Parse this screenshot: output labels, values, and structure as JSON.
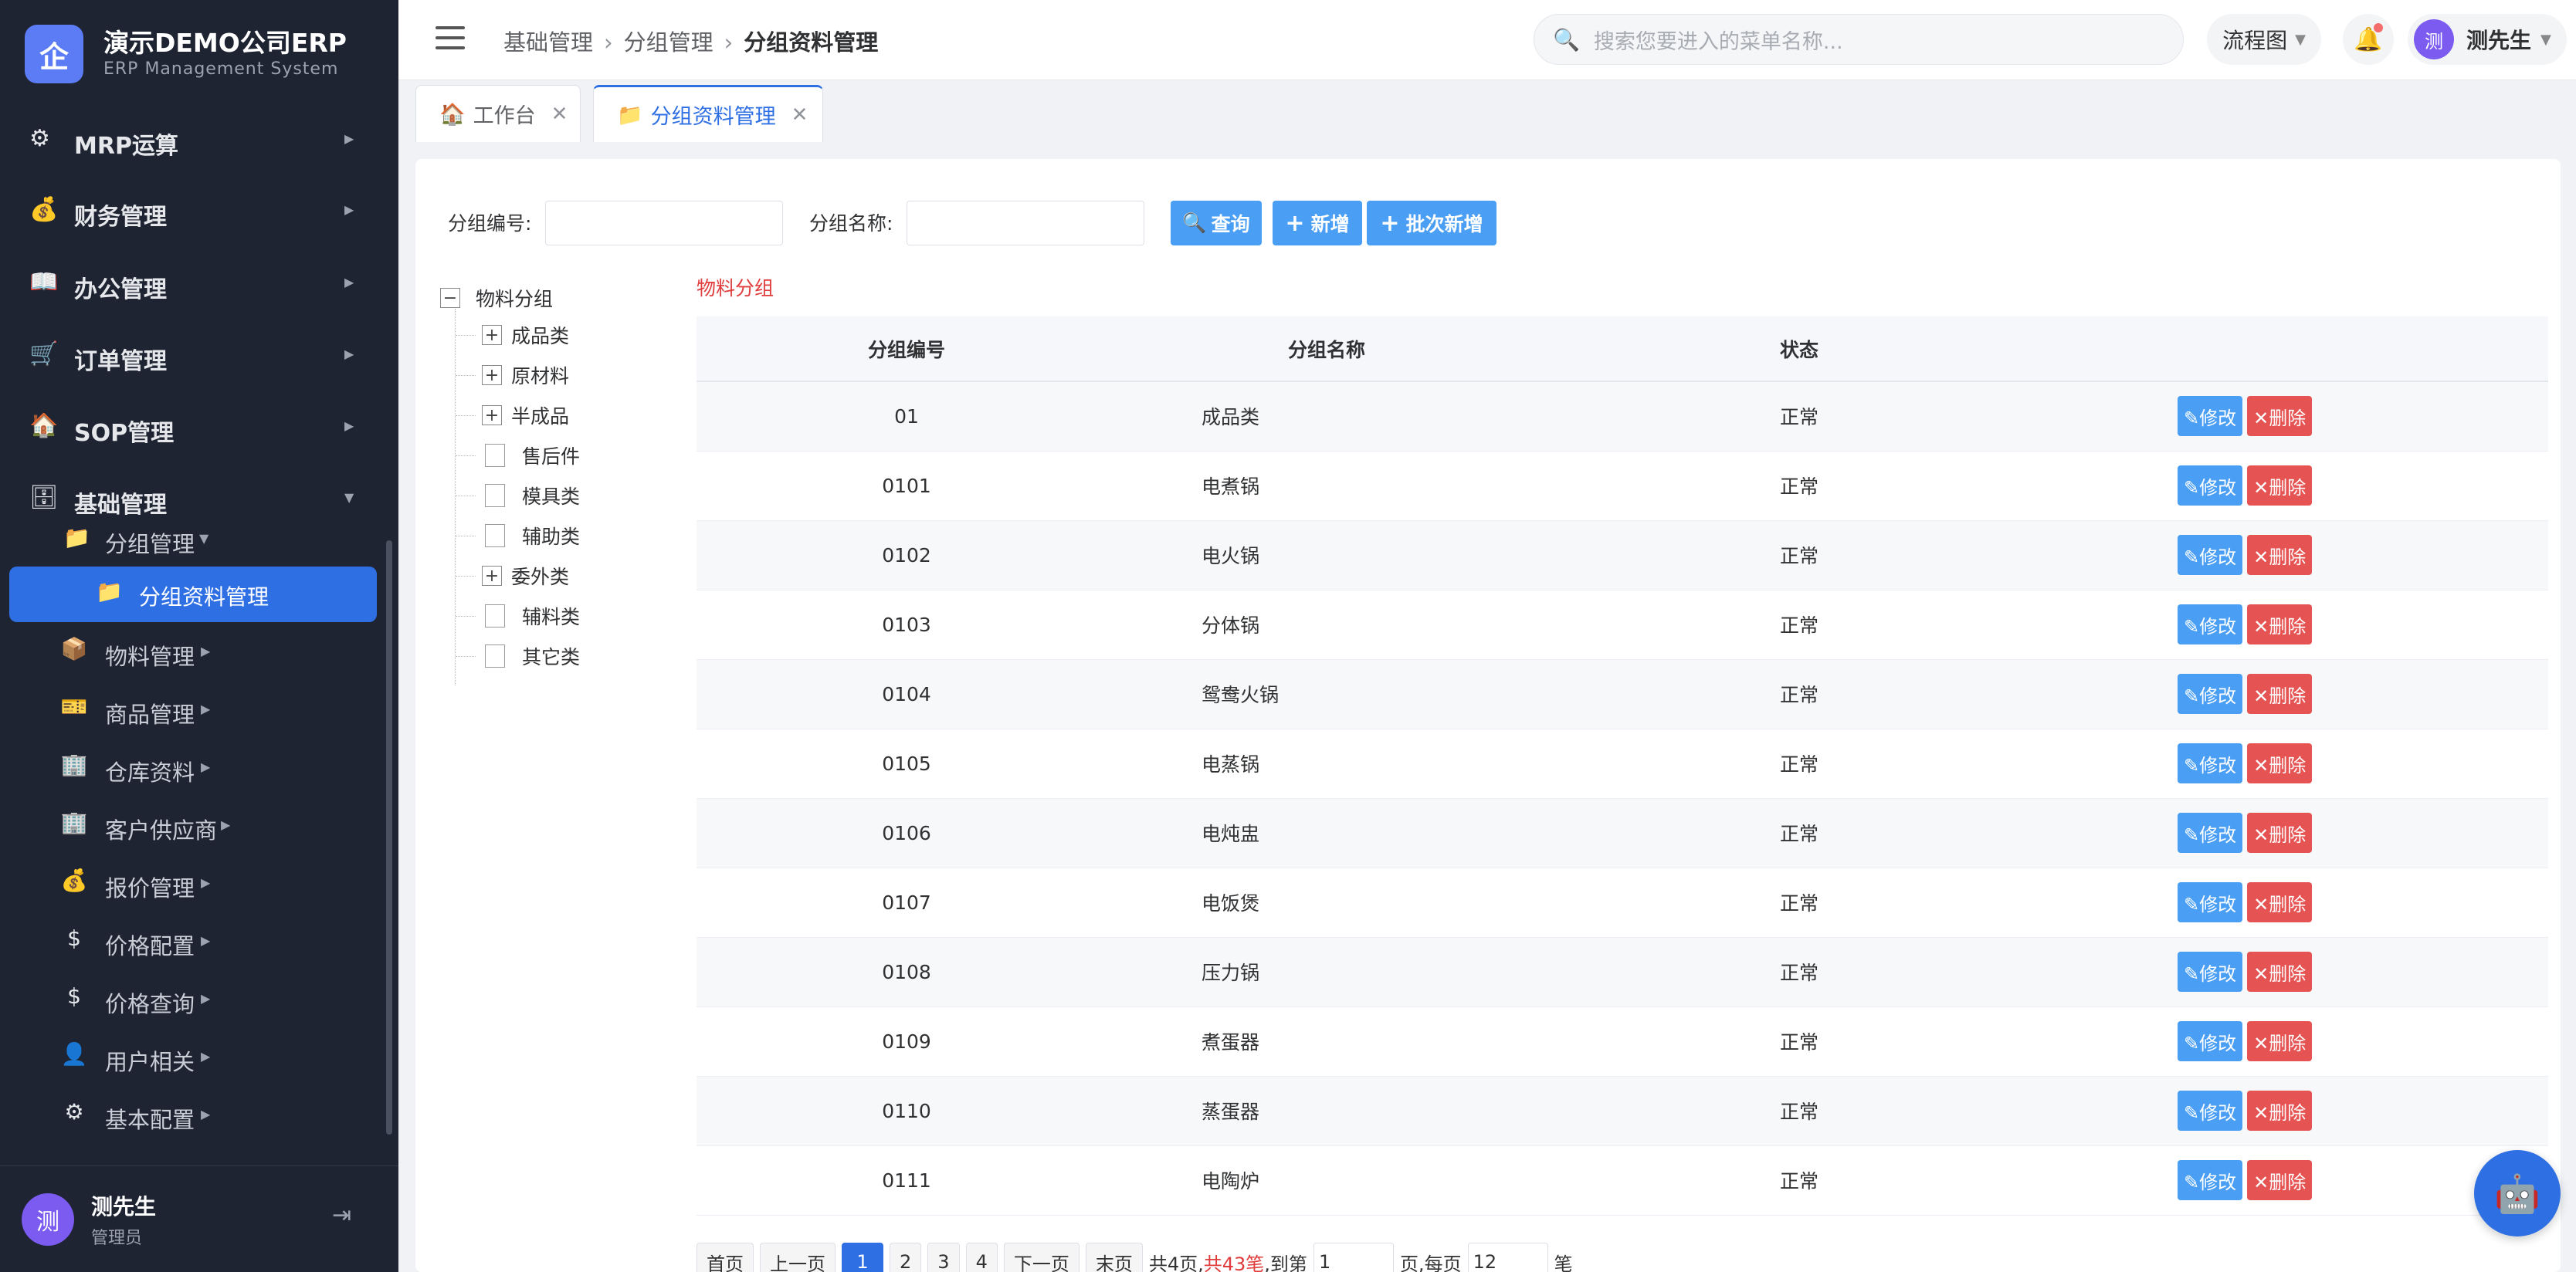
{
  "app": {
    "logo_char": "企",
    "title": "演示DEMO公司ERP",
    "subtitle": "ERP Management System"
  },
  "sidebar": {
    "top_items": [
      {
        "label": "MRP运算",
        "icon": "gear-icon",
        "glyph": "⚙"
      },
      {
        "label": "财务管理",
        "icon": "moneybag-icon",
        "glyph": "💰"
      },
      {
        "label": "办公管理",
        "icon": "book-icon",
        "glyph": "📖"
      },
      {
        "label": "订单管理",
        "icon": "cart-icon",
        "glyph": "🛒"
      },
      {
        "label": "SOP管理",
        "icon": "house-icon",
        "glyph": "🏠"
      },
      {
        "label": "基础管理",
        "icon": "file-cabinet-icon",
        "glyph": "🗄"
      }
    ],
    "group": {
      "label": "分组管理",
      "icon": "folder-icon",
      "glyph": "📁"
    },
    "active": {
      "label": "分组资料管理",
      "icon": "folder-icon",
      "glyph": "📁"
    },
    "sub_items": [
      {
        "label": "物料管理",
        "icon": "package-icon",
        "glyph": "📦"
      },
      {
        "label": "商品管理",
        "icon": "ticket-icon",
        "glyph": "🎫"
      },
      {
        "label": "仓库资料",
        "icon": "building-icon",
        "glyph": "🏢"
      },
      {
        "label": "客户供应商",
        "icon": "building-icon",
        "glyph": "🏢"
      },
      {
        "label": "报价管理",
        "icon": "moneybag-icon",
        "glyph": "💰"
      },
      {
        "label": "价格配置",
        "icon": "dollar-icon",
        "glyph": "$"
      },
      {
        "label": "价格查询",
        "icon": "dollar-icon",
        "glyph": "$"
      },
      {
        "label": "用户相关",
        "icon": "user-icon",
        "glyph": "👤"
      },
      {
        "label": "基本配置",
        "icon": "gear-icon",
        "glyph": "⚙"
      }
    ],
    "user": {
      "avatar": "测",
      "name": "测先生",
      "role": "管理员"
    }
  },
  "header": {
    "breadcrumb": [
      "基础管理",
      "分组管理",
      "分组资料管理"
    ],
    "search_placeholder": "搜索您要进入的菜单名称...",
    "flow_label": "流程图",
    "user_avatar": "测",
    "user_name": "测先生"
  },
  "tabs": [
    {
      "label": "工作台",
      "icon": "🏠"
    },
    {
      "label": "分组资料管理",
      "icon": "📁"
    }
  ],
  "query": {
    "code_label": "分组编号:",
    "name_label": "分组名称:",
    "search_btn": "查询",
    "add_btn": "新增",
    "batch_btn": "批次新增"
  },
  "tree": {
    "root": "物料分组",
    "nodes": [
      {
        "label": "成品类",
        "expandable": true
      },
      {
        "label": "原材料",
        "expandable": true
      },
      {
        "label": "半成品",
        "expandable": true
      },
      {
        "label": "售后件",
        "expandable": false
      },
      {
        "label": "模具类",
        "expandable": false
      },
      {
        "label": "辅助类",
        "expandable": false
      },
      {
        "label": "委外类",
        "expandable": true
      },
      {
        "label": "辅料类",
        "expandable": false
      },
      {
        "label": "其它类",
        "expandable": false
      }
    ]
  },
  "grid": {
    "title": "物料分组",
    "columns": [
      "分组编号",
      "分组名称",
      "状态",
      ""
    ],
    "edit_label": "✎修改",
    "delete_label": "✕删除",
    "rows": [
      {
        "code": "01",
        "name": "成品类",
        "status": "正常"
      },
      {
        "code": "0101",
        "name": "电煮锅",
        "status": "正常"
      },
      {
        "code": "0102",
        "name": "电火锅",
        "status": "正常"
      },
      {
        "code": "0103",
        "name": "分体锅",
        "status": "正常"
      },
      {
        "code": "0104",
        "name": "鸳鸯火锅",
        "status": "正常"
      },
      {
        "code": "0105",
        "name": "电蒸锅",
        "status": "正常"
      },
      {
        "code": "0106",
        "name": "电炖盅",
        "status": "正常"
      },
      {
        "code": "0107",
        "name": "电饭煲",
        "status": "正常"
      },
      {
        "code": "0108",
        "name": "压力锅",
        "status": "正常"
      },
      {
        "code": "0109",
        "name": "煮蛋器",
        "status": "正常"
      },
      {
        "code": "0110",
        "name": "蒸蛋器",
        "status": "正常"
      },
      {
        "code": "0111",
        "name": "电陶炉",
        "status": "正常"
      }
    ]
  },
  "pager": {
    "first": "首页",
    "prev": "上一页",
    "pages": [
      "1",
      "2",
      "3",
      "4"
    ],
    "next": "下一页",
    "last": "末页",
    "total_pages": "共4页,",
    "total_records": "共43笔",
    "goto": ",到第",
    "goto_value": "1",
    "page_unit": "页,每页",
    "per_page": "12",
    "per_unit": "笔"
  }
}
